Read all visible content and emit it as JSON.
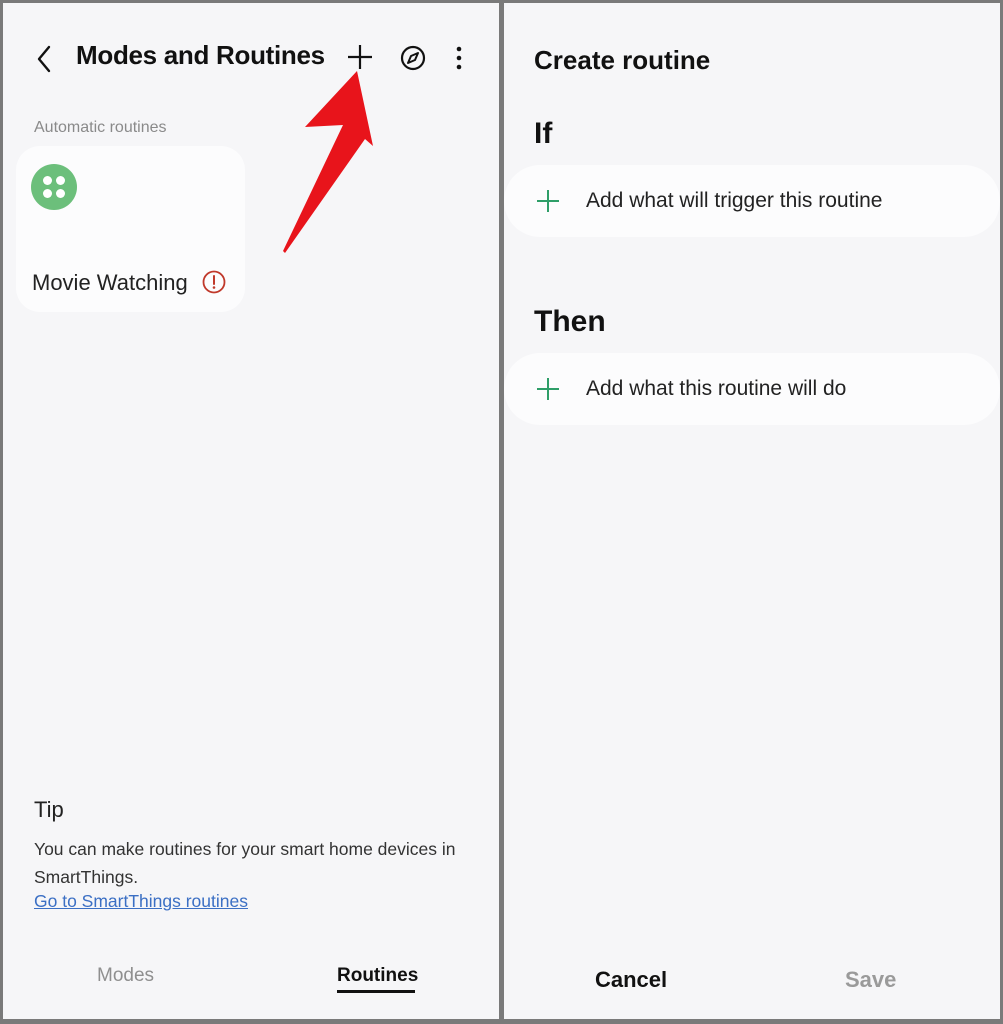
{
  "left_screen": {
    "header": {
      "back_icon": "chevron-left-icon",
      "title": "Modes and Routines",
      "add_icon": "plus-icon",
      "discover_icon": "compass-icon",
      "more_icon": "more-vertical-icon"
    },
    "section_label": "Automatic routines",
    "routines": [
      {
        "name": "Movie Watching",
        "icon": "apps-grid-icon",
        "status_icon": "warning-circle-icon",
        "icon_color": "#6cbf7b",
        "status_color": "#c0392b"
      }
    ],
    "tip": {
      "title": "Tip",
      "body": "You can make routines for your smart home devices in SmartThings.",
      "link": "Go to SmartThings routines"
    },
    "tabs": [
      {
        "label": "Modes",
        "selected": false
      },
      {
        "label": "Routines",
        "selected": true
      }
    ],
    "annotation": {
      "type": "red-arrow",
      "points_to": "plus-icon",
      "color": "#e8141b"
    }
  },
  "right_screen": {
    "title": "Create routine",
    "if_heading": "If",
    "if_action": "Add what will trigger this routine",
    "then_heading": "Then",
    "then_action": "Add what this routine will do",
    "accent": "#2e9e68",
    "buttons": {
      "cancel": "Cancel",
      "save": "Save"
    }
  }
}
